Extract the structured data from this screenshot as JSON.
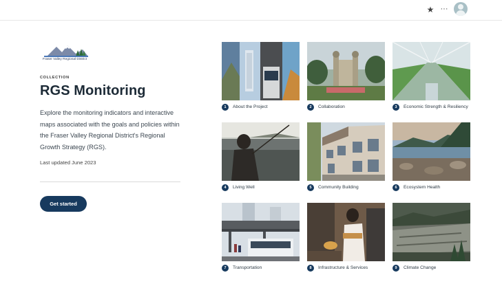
{
  "topbar": {
    "star_icon": "★",
    "more_icon": "···"
  },
  "logo": {
    "text": "Fraser Valley Regional District"
  },
  "eyebrow": "COLLECTION",
  "title": "RGS Monitoring",
  "description": "Explore the monitoring indicators and interactive maps associated with the goals and policies within the Fraser Valley Regional District's Regional Growth Strategy (RGS).",
  "last_updated": "Last updated  June 2023",
  "cta_label": "Get started",
  "cards": [
    {
      "num": "1",
      "label": "About the Project"
    },
    {
      "num": "2",
      "label": "Collaboration"
    },
    {
      "num": "3",
      "label": "Economic Strength & Resiliency"
    },
    {
      "num": "4",
      "label": "Living Well"
    },
    {
      "num": "5",
      "label": "Community Building"
    },
    {
      "num": "6",
      "label": "Ecosystem Health"
    },
    {
      "num": "7",
      "label": "Transportation"
    },
    {
      "num": "8",
      "label": "Infrastructure & Services"
    },
    {
      "num": "9",
      "label": "Climate Change"
    }
  ],
  "colors": {
    "accent": "#173a5e"
  }
}
